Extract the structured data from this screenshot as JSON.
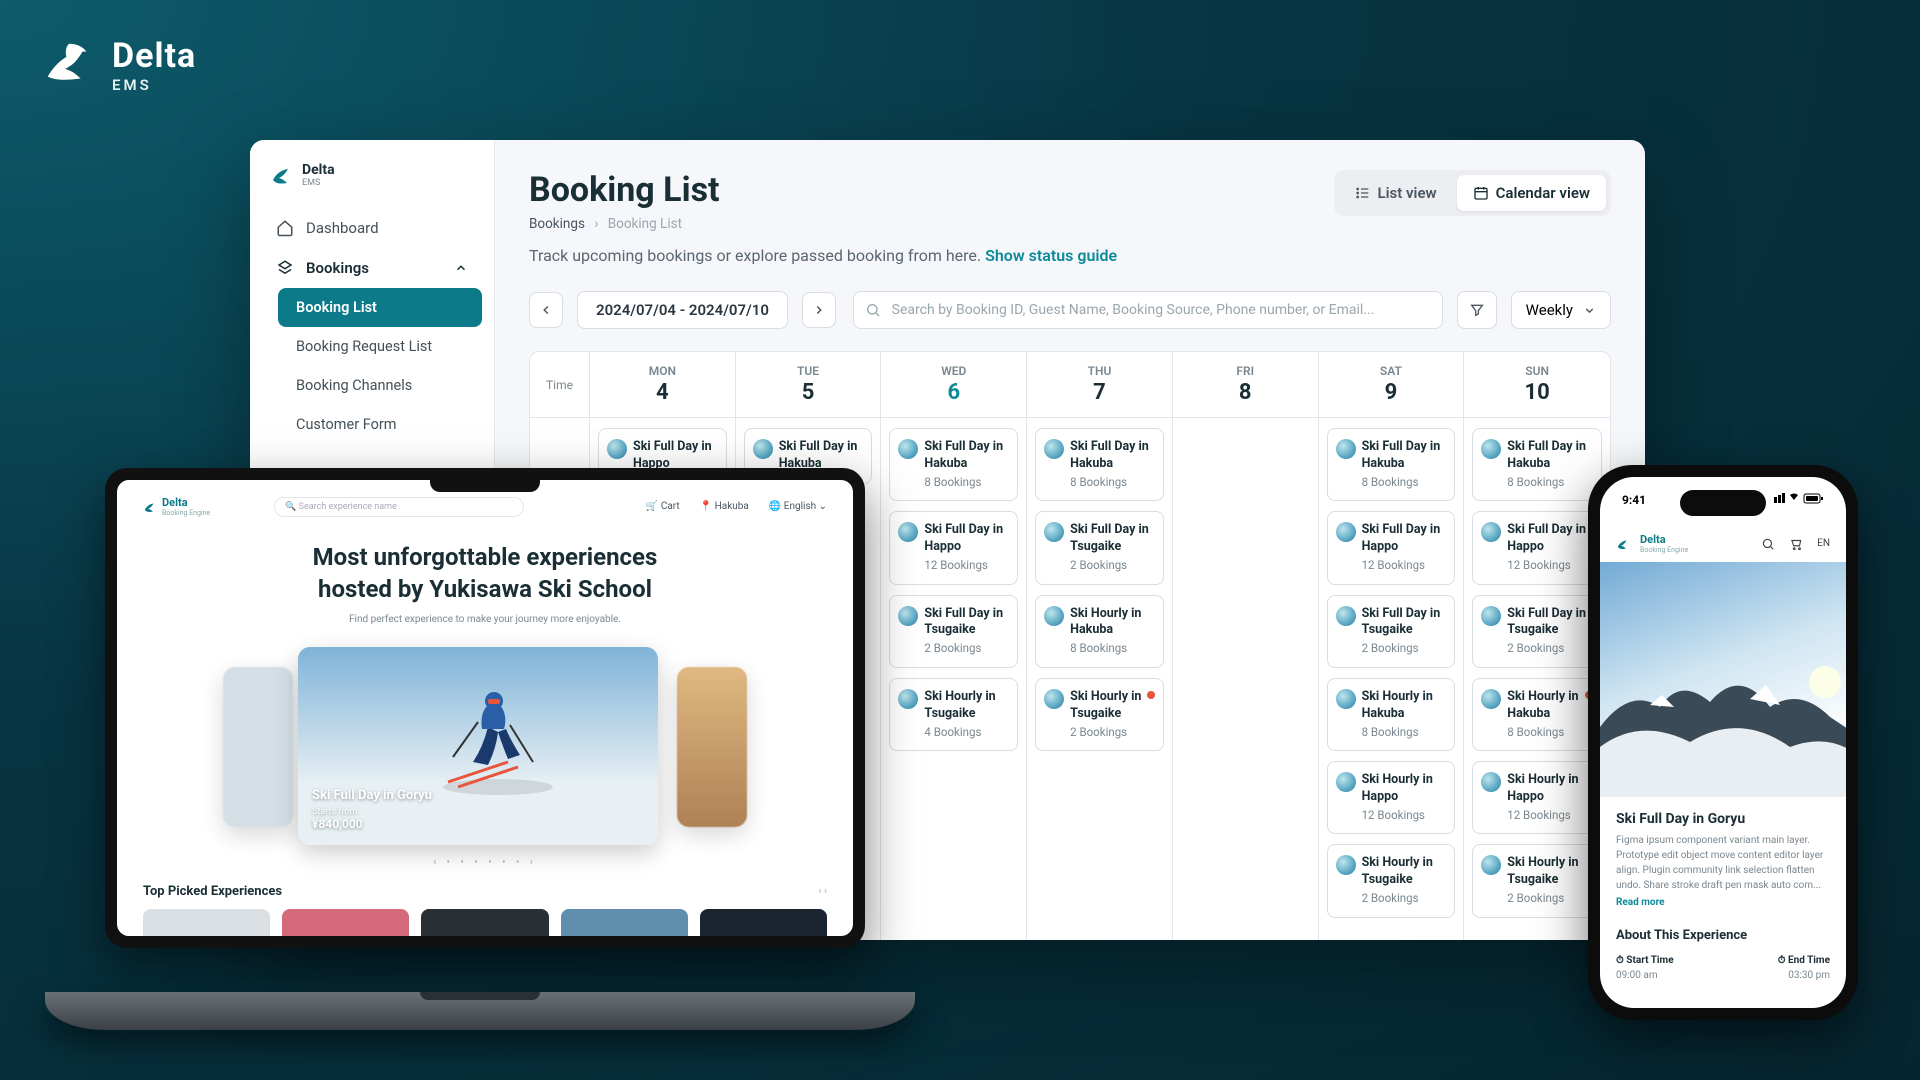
{
  "brand": {
    "name": "Delta",
    "sub": "EMS"
  },
  "sidebar": {
    "brand": {
      "name": "Delta",
      "sub": "EMS"
    },
    "items": [
      {
        "label": "Dashboard"
      },
      {
        "label": "Bookings",
        "expanded": true,
        "children": [
          {
            "label": "Booking List",
            "active": true
          },
          {
            "label": "Booking Request List"
          },
          {
            "label": "Booking Channels"
          },
          {
            "label": "Customer Form"
          }
        ]
      }
    ]
  },
  "page": {
    "title": "Booking List",
    "breadcrumb": {
      "root": "Bookings",
      "current": "Booking List"
    },
    "description": "Track upcoming bookings or explore passed booking from here.",
    "status_guide": "Show status guide"
  },
  "view_toggle": {
    "list": "List view",
    "calendar": "Calendar view",
    "active": "calendar"
  },
  "toolbar": {
    "date_range": "2024/07/04 - 2024/07/10",
    "search_placeholder": "Search by Booking ID, Guest Name, Booking Source, Phone number, or Email...",
    "period": "Weekly"
  },
  "calendar": {
    "time_label": "Time",
    "days": [
      {
        "dow": "MON",
        "num": "4"
      },
      {
        "dow": "TUE",
        "num": "5"
      },
      {
        "dow": "WED",
        "num": "6",
        "today": true
      },
      {
        "dow": "THU",
        "num": "7"
      },
      {
        "dow": "FRI",
        "num": "8"
      },
      {
        "dow": "SAT",
        "num": "9"
      },
      {
        "dow": "SUN",
        "num": "10"
      }
    ],
    "columns": [
      [
        {
          "t": "Ski Full Day in Happo"
        }
      ],
      [
        {
          "t": "Ski Full Day in Hakuba"
        }
      ],
      [
        {
          "t": "Ski Full Day in Hakuba",
          "b": "8 Bookings"
        },
        {
          "t": "Ski Full Day in Happo",
          "b": "12 Bookings"
        },
        {
          "t": "Ski Full Day in Tsugaike",
          "b": "2 Bookings"
        },
        {
          "t": "Ski Hourly in Tsugaike",
          "b": "4 Bookings"
        }
      ],
      [
        {
          "t": "Ski Full Day in Hakuba",
          "b": "8 Bookings"
        },
        {
          "t": "Ski Full Day in Tsugaike",
          "b": "2 Bookings"
        },
        {
          "t": "Ski Hourly in Hakuba",
          "b": "8 Bookings"
        },
        {
          "t": "Ski Hourly in Tsugaike",
          "b": "2 Bookings",
          "alert": true
        }
      ],
      [],
      [
        {
          "t": "Ski Full Day in Hakuba",
          "b": "8 Bookings"
        },
        {
          "t": "Ski Full Day in Happo",
          "b": "12 Bookings"
        },
        {
          "t": "Ski Full Day in Tsugaike",
          "b": "2 Bookings"
        },
        {
          "t": "Ski Hourly in Hakuba",
          "b": "8 Bookings"
        },
        {
          "t": "Ski Hourly in Happo",
          "b": "12 Bookings"
        },
        {
          "t": "Ski Hourly in Tsugaike",
          "b": "2 Bookings"
        }
      ],
      [
        {
          "t": "Ski Full Day in Hakuba",
          "b": "8 Bookings"
        },
        {
          "t": "Ski Full Day in Happo",
          "b": "12 Bookings"
        },
        {
          "t": "Ski Full Day in Tsugaike",
          "b": "2 Bookings"
        },
        {
          "t": "Ski Hourly in Hakuba",
          "b": "8 Bookings",
          "alert": true
        },
        {
          "t": "Ski Hourly in Happo",
          "b": "12 Bookings"
        },
        {
          "t": "Ski Hourly in Tsugaike",
          "b": "2 Bookings"
        }
      ]
    ]
  },
  "laptop": {
    "brand": "Delta",
    "brand_sub": "Booking Engine",
    "search_placeholder": "Search experience name",
    "nav": {
      "cart": "Cart",
      "location": "Hakuba",
      "language": "English"
    },
    "hero": {
      "line1": "Most unforgottable experiences",
      "line2": "hosted by Yukisawa Ski School",
      "sub": "Find perfect experience to make your journey more enjoyable."
    },
    "card": {
      "title": "Ski Full Day in Goryu",
      "starts": "Starts from",
      "price": "¥840,000"
    },
    "section": "Top Picked Experiences",
    "thumb_colors": [
      "#d9dfe3",
      "#d46a7a",
      "#2a2f36",
      "#5f8fad",
      "#1a2530"
    ]
  },
  "phone": {
    "time": "9:41",
    "brand": "Delta",
    "brand_sub": "Booking Engine",
    "lang": "EN",
    "title": "Ski Full Day in Goryu",
    "desc": "Figma ipsum component variant main layer. Prototype edit object move content editor layer align. Plugin community link selection flatten undo. Share stroke draft pen mask auto com...",
    "read_more": "Read more",
    "about": "About This Experience",
    "start_label": "Start Time",
    "start_val": "09:00 am",
    "end_label": "End Time",
    "end_val": "03:30 pm"
  }
}
